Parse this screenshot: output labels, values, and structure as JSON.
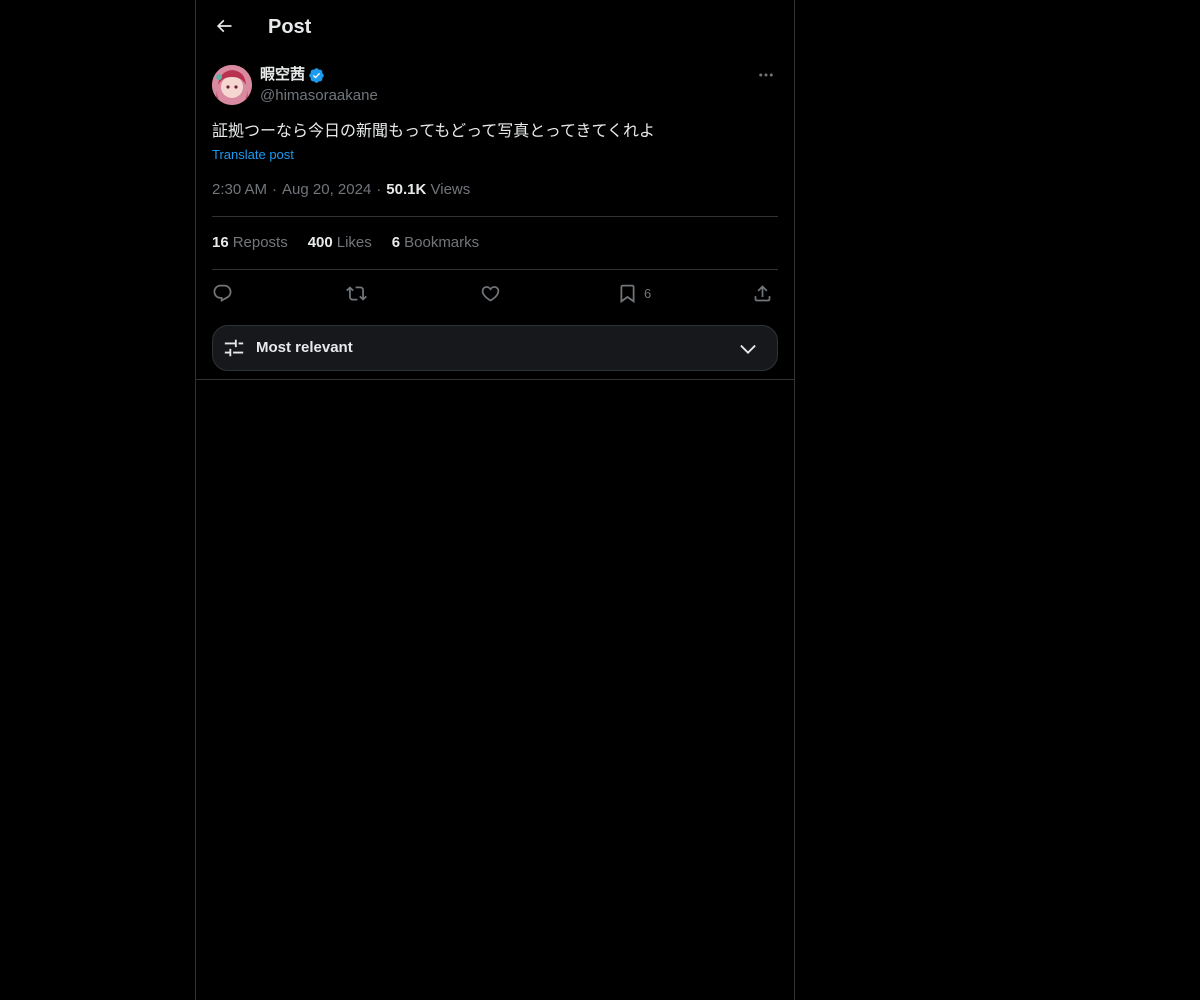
{
  "header": {
    "title": "Post",
    "back_icon": "arrow-left-icon"
  },
  "author": {
    "display_name": "暇空茜",
    "handle": "@himasoraakane",
    "verified": true,
    "verified_color": "#1d9bf0"
  },
  "post": {
    "text": "証拠つーなら今日の新聞もってもどって写真とってきてくれよ",
    "translate_label": "Translate post",
    "time": "2:30 AM",
    "date": "Aug 20, 2024",
    "views_count": "50.1K",
    "views_label": "Views",
    "separator": "·"
  },
  "stats": {
    "reposts_count": "16",
    "reposts_label": "Reposts",
    "likes_count": "400",
    "likes_label": "Likes",
    "bookmarks_count": "6",
    "bookmarks_label": "Bookmarks"
  },
  "actions": {
    "reply_icon": "reply-icon",
    "repost_icon": "repost-icon",
    "like_icon": "heart-icon",
    "bookmark_icon": "bookmark-icon",
    "bookmark_count": "6",
    "share_icon": "share-icon"
  },
  "sort": {
    "label": "Most relevant",
    "icon": "sliders-icon",
    "chevron": "chevron-down-icon"
  },
  "colors": {
    "background": "#000000",
    "text_primary": "#e7e9ea",
    "text_secondary": "#71767b",
    "accent": "#1d9bf0",
    "border": "#2f3336"
  }
}
